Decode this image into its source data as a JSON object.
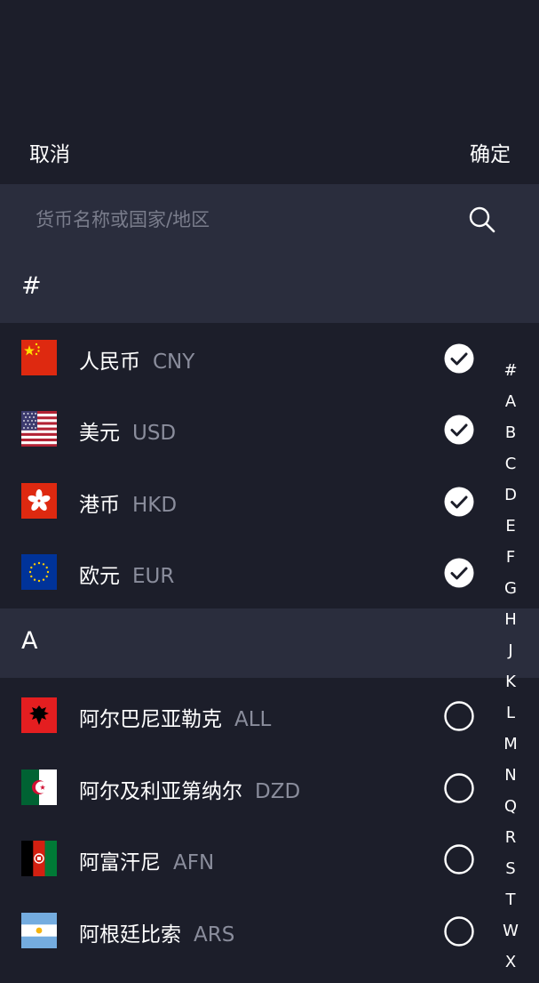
{
  "header": {
    "cancel_label": "取消",
    "confirm_label": "确定"
  },
  "search": {
    "placeholder": "货币名称或国家/地区",
    "value": ""
  },
  "sections": [
    {
      "letter": "#",
      "items": [
        {
          "name": "人民币",
          "code": "CNY",
          "flag": "cn-flag-icon",
          "selected": true
        },
        {
          "name": "美元",
          "code": "USD",
          "flag": "us-flag-icon",
          "selected": true
        },
        {
          "name": "港币",
          "code": "HKD",
          "flag": "hk-flag-icon",
          "selected": true
        },
        {
          "name": "欧元",
          "code": "EUR",
          "flag": "eu-flag-icon",
          "selected": true
        }
      ]
    },
    {
      "letter": "A",
      "items": [
        {
          "name": "阿尔巴尼亚勒克",
          "code": "ALL",
          "flag": "al-flag-icon",
          "selected": false
        },
        {
          "name": "阿尔及利亚第纳尔",
          "code": "DZD",
          "flag": "dz-flag-icon",
          "selected": false
        },
        {
          "name": "阿富汗尼",
          "code": "AFN",
          "flag": "af-flag-icon",
          "selected": false
        },
        {
          "name": "阿根廷比索",
          "code": "ARS",
          "flag": "ar-flag-icon",
          "selected": false
        }
      ]
    }
  ],
  "index_letters": [
    "#",
    "A",
    "B",
    "C",
    "D",
    "E",
    "F",
    "G",
    "H",
    "J",
    "K",
    "L",
    "M",
    "N",
    "Q",
    "R",
    "S",
    "T",
    "W",
    "X"
  ],
  "colors": {
    "background": "#1c1e2a",
    "section_background": "#2a2d3d",
    "code_text": "#8a8d9c",
    "placeholder": "#7a7d8c",
    "text": "#ffffff"
  }
}
